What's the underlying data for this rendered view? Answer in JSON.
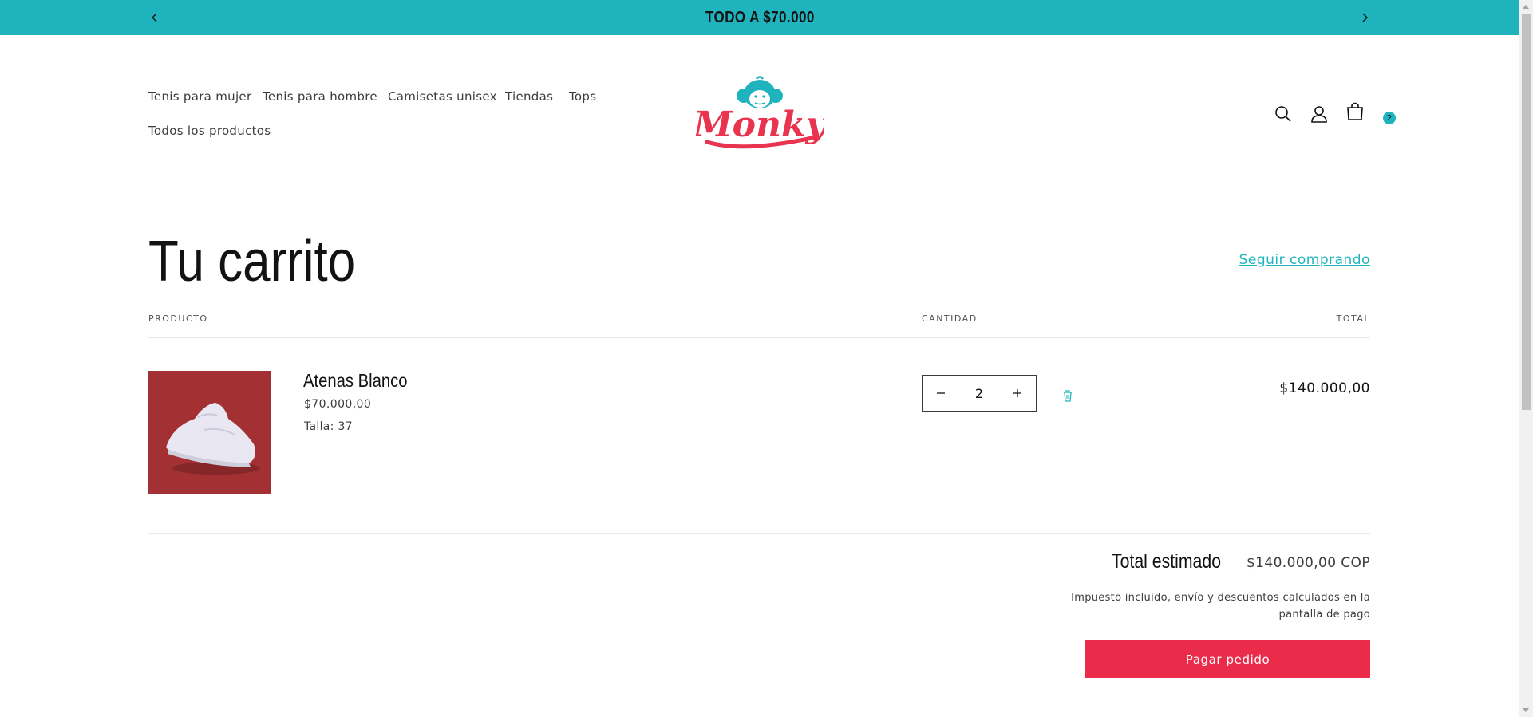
{
  "announcement": {
    "text": "TODO A $70.000",
    "prev_icon": "chevron-left-icon",
    "next_icon": "chevron-right-icon",
    "background": "#1fb4bd"
  },
  "nav": {
    "items": [
      {
        "label": "Tenis para mujer"
      },
      {
        "label": "Tenis para hombre"
      },
      {
        "label": "Camisetas unisex"
      },
      {
        "label": "Tiendas"
      },
      {
        "label": "Tops"
      },
      {
        "label": "Todos los productos"
      }
    ]
  },
  "logo": {
    "text": "Monky",
    "brand_color": "#e8344e",
    "accent_color": "#1fb4bd"
  },
  "header_icons": {
    "search": "search-icon",
    "account": "user-icon",
    "cart": "cart-icon",
    "cart_count": "2"
  },
  "cart": {
    "title": "Tu carrito",
    "continue_label": "Seguir comprando",
    "columns": {
      "product": "PRODUCTO",
      "quantity": "CANTIDAD",
      "total": "TOTAL"
    },
    "items": [
      {
        "name": "Atenas Blanco",
        "price": "$70.000,00",
        "variant": "Talla: 37",
        "quantity": "2",
        "line_total": "$140.000,00",
        "image": "white sneaker on red background"
      }
    ],
    "summary": {
      "label": "Total estimado",
      "value": "$140.000,00 COP",
      "note": "Impuesto incluido, envío y descuentos calculados en la pantalla de pago",
      "checkout_label": "Pagar pedido",
      "checkout_color": "#ea2b4a"
    }
  }
}
